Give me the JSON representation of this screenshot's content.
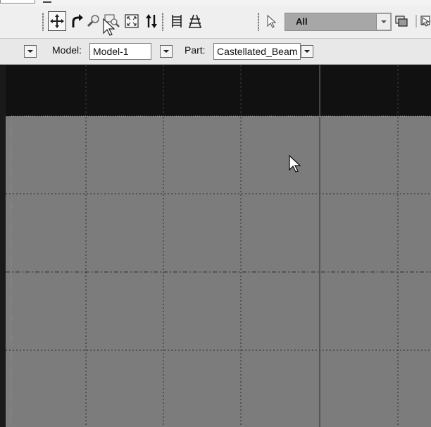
{
  "toolbar": {
    "buttons": [
      {
        "name": "pan-view-icon"
      },
      {
        "name": "rotate-view-icon"
      },
      {
        "name": "magnify-icon"
      },
      {
        "name": "box-zoom-icon"
      },
      {
        "name": "auto-fit-icon"
      },
      {
        "name": "cycle-views-icon"
      },
      {
        "name": "query-icon"
      },
      {
        "name": "align-icon"
      },
      {
        "name": "select-arrow-icon"
      }
    ],
    "selection_filter": "All"
  },
  "context": {
    "model_label": "Model:",
    "model_value": "Model-1",
    "part_label": "Part:",
    "part_value": "Castellated_Beam"
  },
  "colors": {
    "viewport_background": "#7c7c7c",
    "viewport_top_band": "#111111",
    "grid_line": "#3a3a3a"
  }
}
